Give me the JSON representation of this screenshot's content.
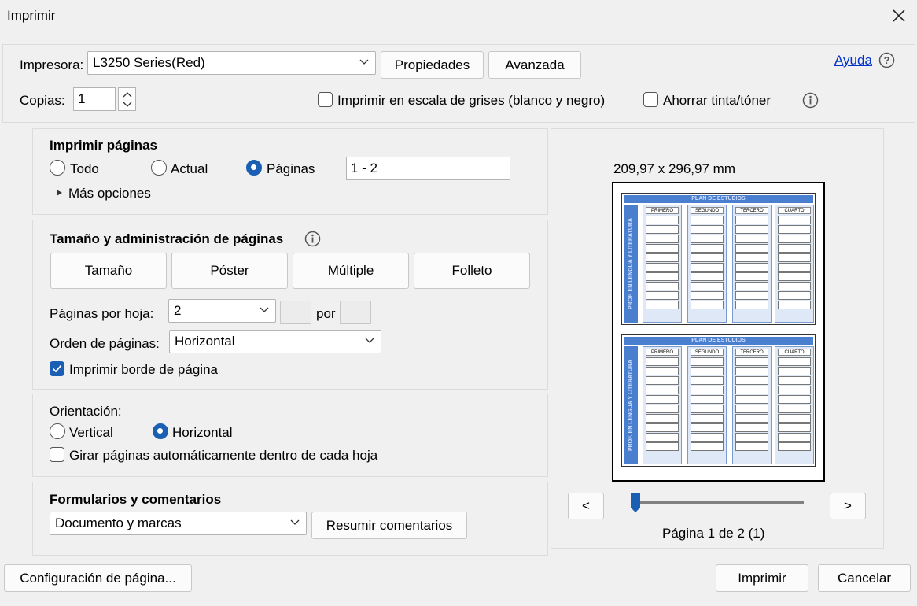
{
  "window": {
    "title": "Imprimir"
  },
  "printer": {
    "label": "Impresora:",
    "value": "L3250 Series(Red)",
    "properties_label": "Propiedades",
    "advanced_label": "Avanzada",
    "help_label": "Ayuda"
  },
  "copies": {
    "label": "Copias:",
    "value": "1"
  },
  "grayscale": {
    "label": "Imprimir en escala de grises (blanco y negro)",
    "checked": false
  },
  "save_ink": {
    "label": "Ahorrar tinta/tóner",
    "checked": false
  },
  "print_pages": {
    "heading": "Imprimir páginas",
    "all_label": "Todo",
    "current_label": "Actual",
    "pages_label": "Páginas",
    "selected": "Páginas",
    "range_value": "1 - 2",
    "more_options": "Más opciones"
  },
  "page_sizing": {
    "heading": "Tamaño y administración de páginas",
    "tabs": [
      "Tamaño",
      "Póster",
      "Múltiple",
      "Folleto"
    ],
    "pages_per_sheet_label": "Páginas por hoja:",
    "pages_per_sheet_value": "2",
    "by_label": "por",
    "order_label": "Orden de páginas:",
    "order_value": "Horizontal",
    "border_label": "Imprimir borde de página",
    "border_checked": true
  },
  "orientation": {
    "heading": "Orientación:",
    "portrait_label": "Vertical",
    "landscape_label": "Horizontal",
    "selected": "Horizontal",
    "autorotate_label": "Girar páginas automáticamente dentro de cada hoja",
    "autorotate_checked": false
  },
  "forms": {
    "heading": "Formularios y comentarios",
    "value": "Documento y marcas",
    "summarize_label": "Resumir comentarios"
  },
  "preview": {
    "size_text": "209,97 x 296,97 mm",
    "sheet_title": "PLAN DE ESTUDIOS",
    "sheet_side": "PROF. EN LENGUA Y LITERATURA",
    "sheet_columns": [
      "PRIMERO",
      "SEGUNDO",
      "TERCERO",
      "CUARTO"
    ],
    "prev_label": "<",
    "next_label": ">",
    "page_text": "Página 1 de 2 (1)"
  },
  "footer": {
    "page_setup_label": "Configuración de página...",
    "print_label": "Imprimir",
    "cancel_label": "Cancelar"
  },
  "colors": {
    "accent": "#1a5fb4",
    "preview_blue": "#4a7fd0"
  }
}
